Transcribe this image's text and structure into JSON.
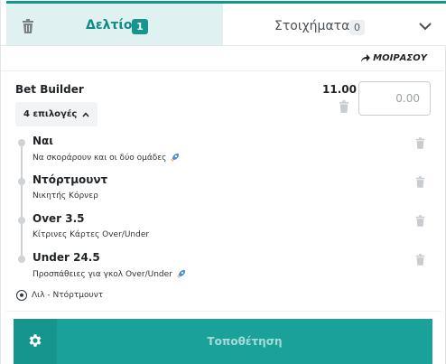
{
  "tabs": {
    "active": {
      "label": "Δελτίο",
      "count": "1"
    },
    "inactive": {
      "label": "Στοιχήματα",
      "count": "0"
    }
  },
  "share_label": "ΜΟΙΡΑΣΟΥ",
  "bet": {
    "title": "Bet Builder",
    "odds": "11.00",
    "stake_placeholder": "0.00",
    "selections_label": "4 επιλογές",
    "legs": [
      {
        "title": "Ναι",
        "market": "Να σκοράρουν και οι δύο ομάδες",
        "boost_icon": "rocket-icon"
      },
      {
        "title": "Ντόρτμουντ",
        "market": "Νικητής Κόρνερ"
      },
      {
        "title": "Over 3.5",
        "market": "Κίτρινες Κάρτες Over/Under"
      },
      {
        "title": "Under 24.5",
        "market": "Προσπάθειες για γκολ Over/Under",
        "boost_icon": "rocket-icon"
      }
    ],
    "match": "Λιλ - Ντόρτμουντ"
  },
  "footer": {
    "place_label": "Τοποθέτηση"
  },
  "colors": {
    "accent": "#16958f",
    "accent_light": "#dff1f0",
    "button": "#19a19a"
  }
}
